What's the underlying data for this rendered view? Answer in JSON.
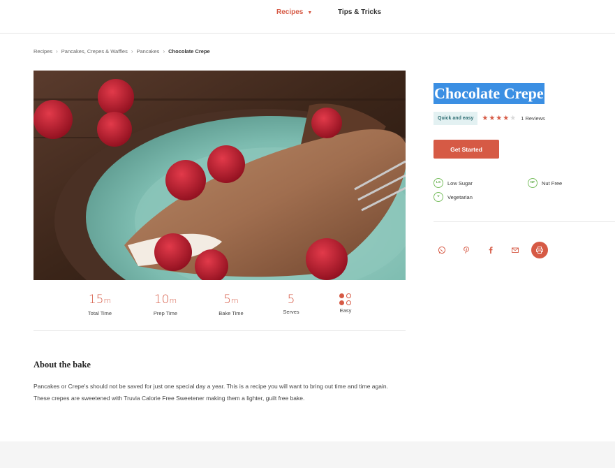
{
  "nav": {
    "recipes_label": "Recipes",
    "tips_label": "Tips & Tricks"
  },
  "breadcrumb": {
    "items": [
      "Recipes",
      "Pancakes, Crepes & Waffles",
      "Pancakes"
    ],
    "current": "Chocolate Crepe"
  },
  "recipe": {
    "title": "Chocolate Crepe",
    "tag": "Quick and easy",
    "rating": 4,
    "rating_max": 5,
    "reviews_label": "1 Reviews",
    "cta_label": "Get Started",
    "diets": [
      {
        "badge": "LS",
        "label": "Low Sugar"
      },
      {
        "badge": "NF",
        "label": "Nut Free"
      },
      {
        "badge": "V",
        "label": "Vegetarian"
      }
    ]
  },
  "stats": [
    {
      "value": "15",
      "unit": "m",
      "label": "Total Time"
    },
    {
      "value": "10",
      "unit": "m",
      "label": "Prep Time"
    },
    {
      "value": "5",
      "unit": "m",
      "label": "Bake Time"
    },
    {
      "value": "5",
      "unit": "",
      "label": "Serves"
    },
    {
      "value": "",
      "unit": "",
      "label": "Easy"
    }
  ],
  "about": {
    "title": "About the bake",
    "body": "Pancakes or Crepe's should not be saved for just one special day a year. This is a recipe you will want to bring out time and time again. These crepes are sweetened with Truvia Calorie Free Sweetener making them a lighter, guilt free bake."
  },
  "share": {
    "icons": [
      "whatsapp-icon",
      "pinterest-icon",
      "facebook-icon",
      "email-icon",
      "print-icon"
    ]
  },
  "colors": {
    "accent": "#d65a45",
    "star_filled": "#d65a45",
    "star_empty": "#d9d9d9",
    "tag_bg": "#e3f1f2",
    "diet_green": "#7bbf62",
    "title_highlight": "#3b8fe3"
  }
}
